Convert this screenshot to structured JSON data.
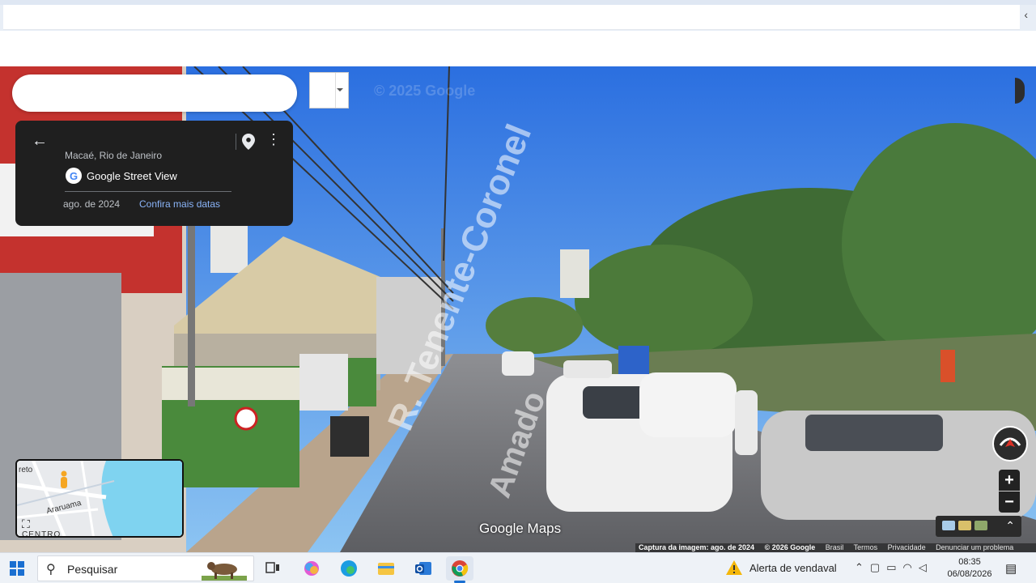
{
  "info_card": {
    "location": "Macaé, Rio de Janeiro",
    "product": "Google Street View",
    "capture_date": "ago. de 2024",
    "more_dates_link": "Confira mais datas"
  },
  "watermark": "© 2025 Google",
  "street_labels": [
    "R. Tenente-Coronel",
    "Amado"
  ],
  "map_logo": "Google Maps",
  "minimap": {
    "labels": [
      "reto",
      "Araruama",
      "CENTRO"
    ]
  },
  "zoom": {
    "in": "+",
    "out": "−"
  },
  "attribution": {
    "capture": "Captura da imagem: ago. de 2024",
    "copyright": "© 2026 Google",
    "country": "Brasil",
    "terms": "Termos",
    "privacy": "Privacidade",
    "report": "Denunciar um problema"
  },
  "taskbar": {
    "search_placeholder": "Pesquisar",
    "weather_alert": "Alerta de vendaval",
    "time": "08:35",
    "date": "06/08/2026"
  },
  "icons": [
    "back-arrow-icon",
    "pin-icon",
    "more-vert-icon",
    "expand-icon",
    "compass-icon",
    "windows-start-icon",
    "search-icon",
    "task-view-icon",
    "copilot-icon",
    "edge-icon",
    "file-explorer-icon",
    "outlook-icon",
    "chrome-icon",
    "weather-alert-icon",
    "chevron-up-icon",
    "wifi-icon",
    "volume-icon",
    "battery-icon",
    "notification-icon"
  ]
}
